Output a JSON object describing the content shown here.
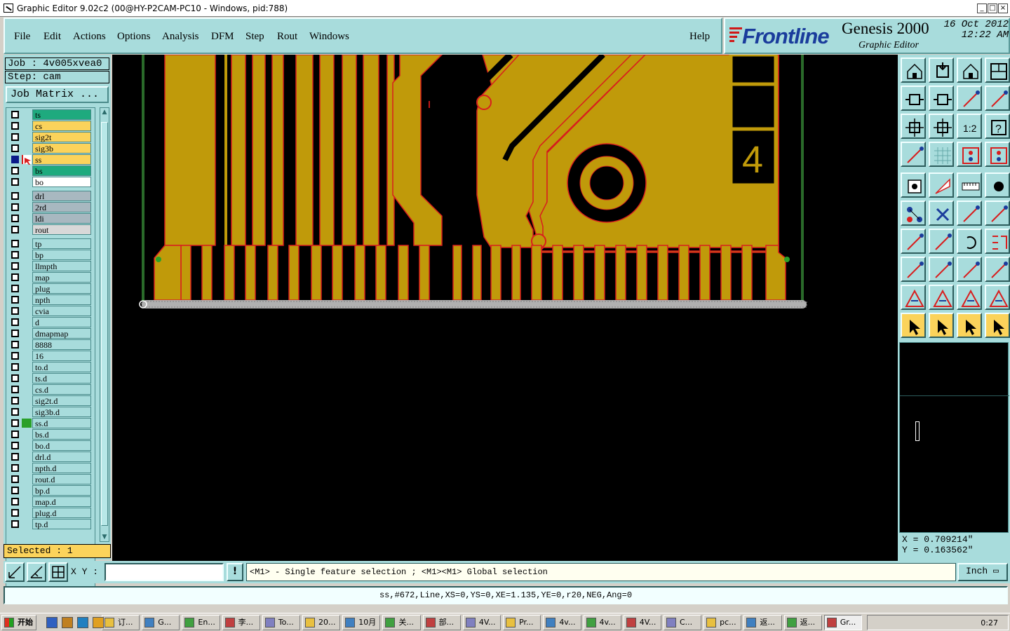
{
  "window": {
    "title": "Graphic Editor 9.02c2 (00@HY-P2CAM-PC10 - Windows, pid:788)",
    "controls": [
      "_",
      "□",
      "×"
    ]
  },
  "menu": {
    "items": [
      "File",
      "Edit",
      "Actions",
      "Options",
      "Analysis",
      "DFM",
      "Step",
      "Rout",
      "Windows"
    ],
    "help": "Help"
  },
  "brand": {
    "logo": "Frontline",
    "product": "Genesis 2000",
    "subtitle": "Graphic Editor",
    "date": "16 Oct 2012",
    "time": "12:22 AM"
  },
  "job": {
    "job_label": "Job : 4v005xvea0",
    "step_label": "Step: cam",
    "matrix_button": "Job Matrix ..."
  },
  "layers": [
    {
      "name": "ts",
      "color": "#1eaa7e",
      "group": 1
    },
    {
      "name": "cs",
      "color": "#fbd35b",
      "group": 1
    },
    {
      "name": "sig2t",
      "color": "#fbd35b",
      "group": 1
    },
    {
      "name": "sig3b",
      "color": "#fbd35b",
      "group": 1
    },
    {
      "name": "ss",
      "color": "#fbd35b",
      "group": 1,
      "active": true,
      "work": true
    },
    {
      "name": "bs",
      "color": "#1eaa7e",
      "group": 1
    },
    {
      "name": "bo",
      "color": "#ffffff",
      "group": 1
    },
    {
      "name": "drl",
      "color": "#a8b8c0",
      "group": 2
    },
    {
      "name": "2rd",
      "color": "#a8b8c0",
      "group": 2
    },
    {
      "name": "ldi",
      "color": "#a8b8c0",
      "group": 2
    },
    {
      "name": "rout",
      "color": "#d8d8d8",
      "group": 2
    },
    {
      "name": "tp",
      "color": "#a8dcdc",
      "group": 3
    },
    {
      "name": "bp",
      "color": "#a8dcdc",
      "group": 3
    },
    {
      "name": "llmpth",
      "color": "#a8dcdc",
      "group": 3
    },
    {
      "name": "map",
      "color": "#a8dcdc",
      "group": 3
    },
    {
      "name": "plug",
      "color": "#a8dcdc",
      "group": 3
    },
    {
      "name": "npth",
      "color": "#a8dcdc",
      "group": 3
    },
    {
      "name": "cvia",
      "color": "#a8dcdc",
      "group": 3
    },
    {
      "name": "d",
      "color": "#a8dcdc",
      "group": 3
    },
    {
      "name": "dmapmap",
      "color": "#a8dcdc",
      "group": 3
    },
    {
      "name": "8888",
      "color": "#a8dcdc",
      "group": 3
    },
    {
      "name": "16",
      "color": "#a8dcdc",
      "group": 3
    },
    {
      "name": "to.d",
      "color": "#a8dcdc",
      "group": 3
    },
    {
      "name": "ts.d",
      "color": "#a8dcdc",
      "group": 3
    },
    {
      "name": "cs.d",
      "color": "#a8dcdc",
      "group": 3
    },
    {
      "name": "sig2t.d",
      "color": "#a8dcdc",
      "group": 3
    },
    {
      "name": "sig3b.d",
      "color": "#a8dcdc",
      "group": 3
    },
    {
      "name": "ss.d",
      "color": "#a8dcdc",
      "group": 3,
      "marker": true
    },
    {
      "name": "bs.d",
      "color": "#a8dcdc",
      "group": 3
    },
    {
      "name": "bo.d",
      "color": "#a8dcdc",
      "group": 3
    },
    {
      "name": "drl.d",
      "color": "#a8dcdc",
      "group": 3
    },
    {
      "name": "npth.d",
      "color": "#a8dcdc",
      "group": 3
    },
    {
      "name": "rout.d",
      "color": "#a8dcdc",
      "group": 3
    },
    {
      "name": "bp.d",
      "color": "#a8dcdc",
      "group": 3
    },
    {
      "name": "map.d",
      "color": "#a8dcdc",
      "group": 3
    },
    {
      "name": "plug.d",
      "color": "#a8dcdc",
      "group": 3
    },
    {
      "name": "tp.d",
      "color": "#a8dcdc",
      "group": 3
    }
  ],
  "selected": "Selected : 1",
  "coords": {
    "x": "X = 0.709214\"",
    "y": "Y = 0.163562\""
  },
  "status": {
    "xy_label": "X Y :",
    "xy_value": "",
    "excl": "!",
    "prompt": "<M1> - Single feature selection ; <M1><M1> Global selection",
    "unit": "Inch ▭",
    "feature_info": "ss,#672,Line,XS=0,YS=0,XE=1.135,YE=0,r20,NEG,Ang=0"
  },
  "board": {
    "copper_color": "#c09a0a",
    "outline_color": "#d81e1e",
    "label": "4"
  },
  "toolbar_icons": [
    "zoom-home-icon",
    "zoom-out-icon",
    "home-icon",
    "window-layout-icon",
    "pan-left-icon",
    "pan-right-icon",
    "flip-icon",
    "snap-icon",
    "zoom-fit-icon",
    "zoom-center-icon",
    "scale-1-2-icon",
    "help-icon",
    "measure-tool-icon",
    "grid-icon",
    "layer-compare-icon",
    "layer-compare-2-icon",
    "pad-icon",
    "polygon-icon",
    "ruler-icon",
    "dot-icon",
    "nodes-icon",
    "delete-node-icon",
    "line-add-icon",
    "line-move-icon",
    "angle-icon",
    "line-draw-icon",
    "undo-arc-icon",
    "mirror-icon",
    "feature-add-icon",
    "cut-line-icon",
    "resize-icon",
    "shape-group-icon",
    "triangle-outline-icon",
    "triangle-a-icon",
    "triangle-bar-icon",
    "triangle-measure-icon",
    "select-arrow-icon",
    "select-box-icon",
    "select-rotate-icon",
    "select-route-icon"
  ],
  "taskbar": {
    "start": "开始",
    "buttons": [
      "订...",
      "G...",
      "En...",
      "李...",
      "To...",
      "20...",
      "10月",
      "关...",
      "部...",
      "4V...",
      "Pr...",
      "4v...",
      "4v...",
      "4V...",
      "C...",
      "pc...",
      "返...",
      "返...",
      "Gr..."
    ],
    "clock": "0:27"
  }
}
